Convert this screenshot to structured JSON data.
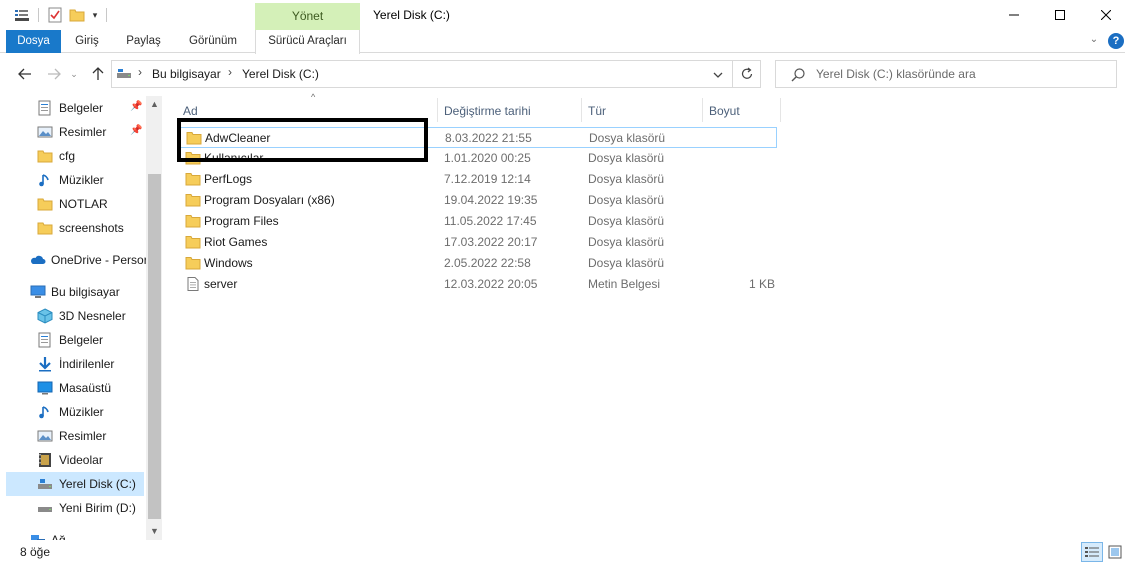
{
  "window": {
    "title": "Yerel Disk (C:)",
    "manage_tab": "Yönet"
  },
  "ribbon": {
    "tabs": [
      "Dosya",
      "Giriş",
      "Paylaş",
      "Görünüm",
      "Sürücü Araçları"
    ],
    "help_label": "?"
  },
  "address": {
    "crumbs": [
      "Bu bilgisayar",
      "Yerel Disk (C:)"
    ],
    "separator": "›"
  },
  "search": {
    "placeholder": "Yerel Disk (C:) klasöründe ara"
  },
  "sidebar": {
    "quick_access": [
      {
        "label": "Belgeler",
        "icon": "documents-icon",
        "pinned": true
      },
      {
        "label": "Resimler",
        "icon": "pictures-icon",
        "pinned": true
      },
      {
        "label": "cfg",
        "icon": "folder-icon",
        "pinned": false
      },
      {
        "label": "Müzikler",
        "icon": "music-icon",
        "pinned": false
      },
      {
        "label": "NOTLAR",
        "icon": "folder-icon",
        "pinned": false
      },
      {
        "label": "screenshots",
        "icon": "folder-icon",
        "pinned": false
      }
    ],
    "onedrive": {
      "label": "OneDrive - Persor",
      "icon": "onedrive-icon"
    },
    "this_pc": {
      "label": "Bu bilgisayar",
      "icon": "computer-icon"
    },
    "pc_items": [
      {
        "label": "3D Nesneler",
        "icon": "3d-objects-icon"
      },
      {
        "label": "Belgeler",
        "icon": "documents-icon"
      },
      {
        "label": "İndirilenler",
        "icon": "downloads-icon"
      },
      {
        "label": "Masaüstü",
        "icon": "desktop-icon"
      },
      {
        "label": "Müzikler",
        "icon": "music-icon"
      },
      {
        "label": "Resimler",
        "icon": "pictures-icon"
      },
      {
        "label": "Videolar",
        "icon": "videos-icon"
      },
      {
        "label": "Yerel Disk (C:)",
        "icon": "drive-icon",
        "selected": true
      },
      {
        "label": "Yeni Birim (D:)",
        "icon": "drive-icon"
      }
    ],
    "network_partial": {
      "label": "Ağ",
      "icon": "network-icon"
    }
  },
  "columns": {
    "name": "Ad",
    "date": "Değiştirme tarihi",
    "type": "Tür",
    "size": "Boyut"
  },
  "files": [
    {
      "name": "AdwCleaner",
      "date": "8.03.2022 21:55",
      "type": "Dosya klasörü",
      "size": "",
      "kind": "folder",
      "selected": true
    },
    {
      "name": "Kullanıcılar",
      "date": "1.01.2020 00:25",
      "type": "Dosya klasörü",
      "size": "",
      "kind": "folder"
    },
    {
      "name": "PerfLogs",
      "date": "7.12.2019 12:14",
      "type": "Dosya klasörü",
      "size": "",
      "kind": "folder"
    },
    {
      "name": "Program Dosyaları (x86)",
      "date": "19.04.2022 19:35",
      "type": "Dosya klasörü",
      "size": "",
      "kind": "folder"
    },
    {
      "name": "Program Files",
      "date": "11.05.2022 17:45",
      "type": "Dosya klasörü",
      "size": "",
      "kind": "folder"
    },
    {
      "name": "Riot Games",
      "date": "17.03.2022 20:17",
      "type": "Dosya klasörü",
      "size": "",
      "kind": "folder"
    },
    {
      "name": "Windows",
      "date": "2.05.2022 22:58",
      "type": "Dosya klasörü",
      "size": "",
      "kind": "folder"
    },
    {
      "name": "server",
      "date": "12.03.2022 20:05",
      "type": "Metin Belgesi",
      "size": "1 KB",
      "kind": "text"
    }
  ],
  "status": {
    "item_count": "8 öğe"
  },
  "colors": {
    "accent": "#1979ca",
    "manage_tab_bg": "#d4f0b8",
    "selection": "#cce8ff",
    "folder": "#f6cd5a"
  }
}
